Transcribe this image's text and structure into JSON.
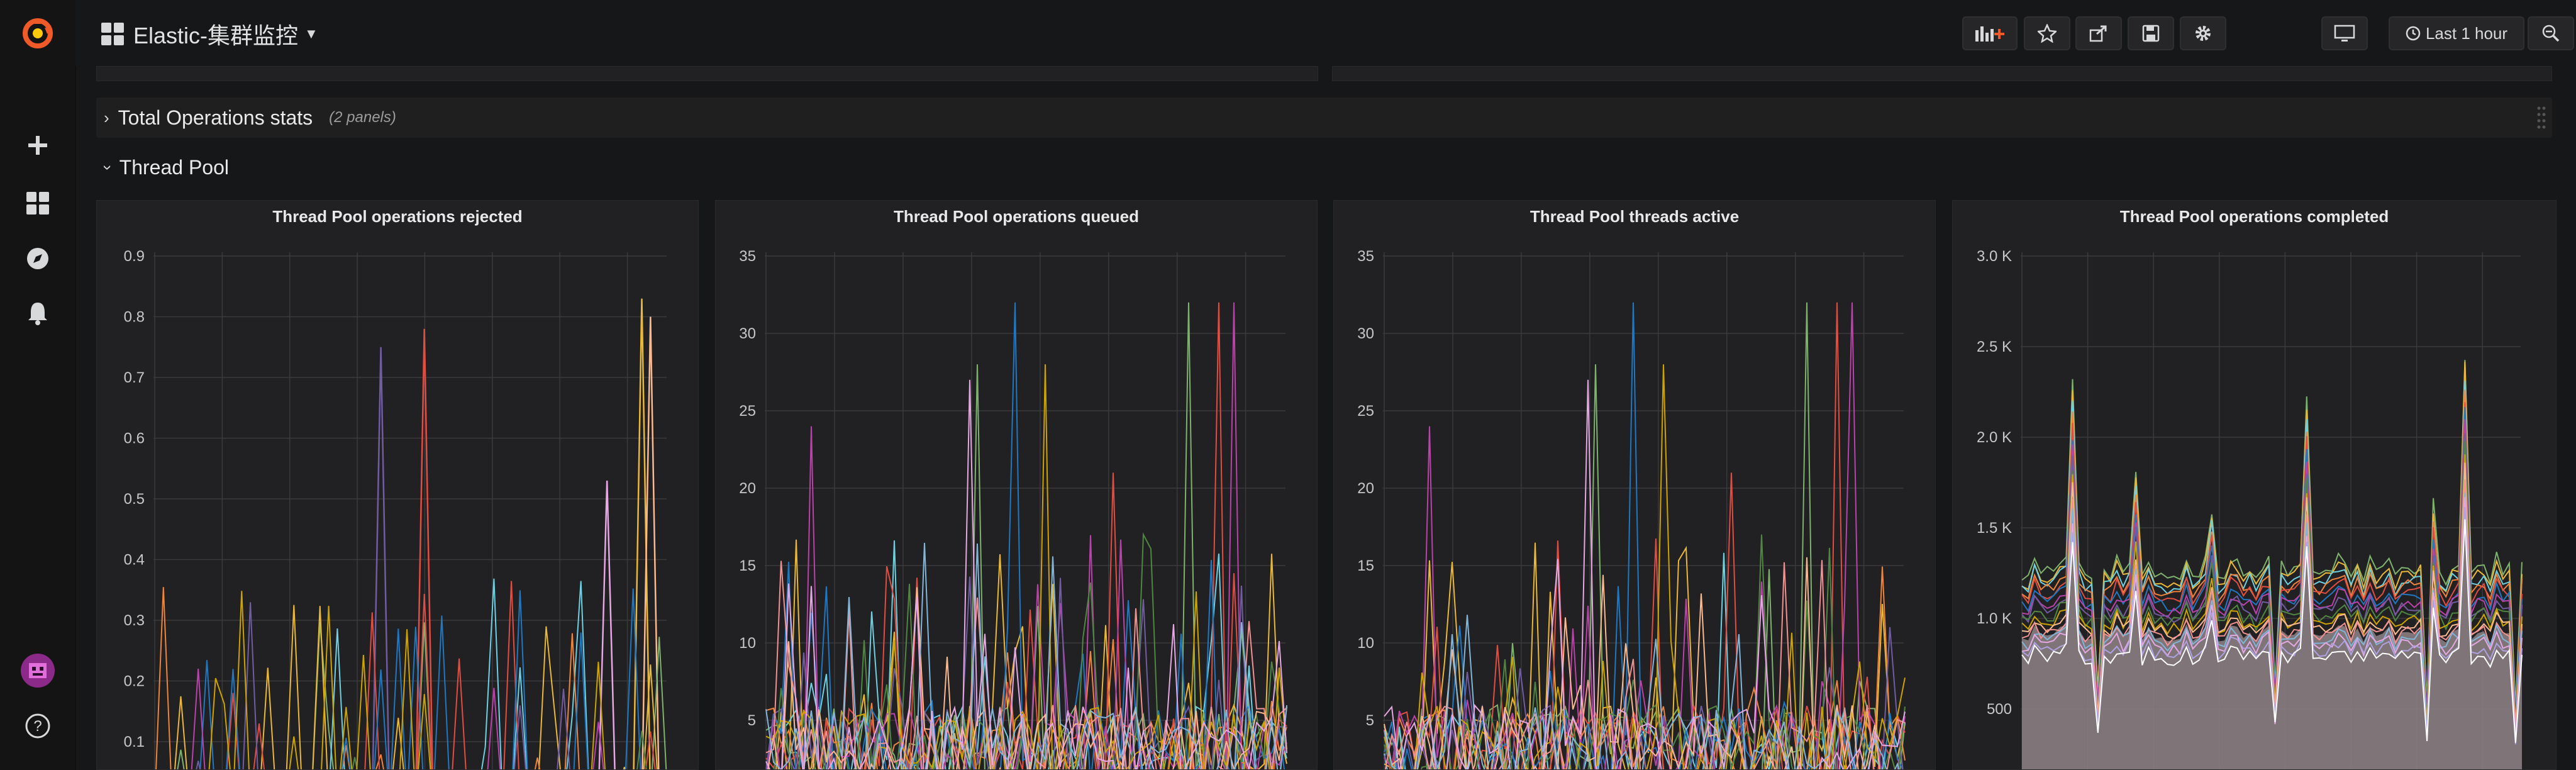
{
  "dashboard": {
    "title": "Elastic-集群监控"
  },
  "toolbar": {
    "time_range_label": "Last 1 hour"
  },
  "sidebar": {
    "items": [
      "grafana-logo",
      "create",
      "dashboards",
      "explore",
      "alerting",
      "user-avatar",
      "help"
    ]
  },
  "rows": [
    {
      "title": "Total Operations stats",
      "count_label": "(2 panels)",
      "collapsed": true
    },
    {
      "title": "Thread Pool",
      "collapsed": false
    }
  ],
  "panels": [
    {
      "title": "Thread Pool operations rejected",
      "yticks": [
        "0.9",
        "0.8",
        "0.7",
        "0.6",
        "0.5",
        "0.4",
        "0.3",
        "0.2",
        "0.1"
      ]
    },
    {
      "title": "Thread Pool operations queued",
      "yticks": [
        "35",
        "30",
        "25",
        "20",
        "15",
        "10",
        "5"
      ]
    },
    {
      "title": "Thread Pool threads active",
      "yticks": [
        "35",
        "30",
        "25",
        "20",
        "15",
        "10",
        "5"
      ]
    },
    {
      "title": "Thread Pool operations completed",
      "yticks": [
        "3.0 K",
        "2.5 K",
        "2.0 K",
        "1.5 K",
        "1.0 K",
        "500"
      ]
    }
  ],
  "colors": {
    "background": "#161719",
    "panel": "#212124",
    "accent": "#f05a28",
    "series": [
      "#7eb26d",
      "#eab839",
      "#6ed0e0",
      "#ef843c",
      "#e24d42",
      "#1f78c1",
      "#ba43a9",
      "#705da0",
      "#508642",
      "#cca300",
      "#f9ba8f",
      "#f29191",
      "#82b5d8",
      "#e5a8e2",
      "#aea2e0",
      "#ffffff"
    ]
  },
  "chart_data": [
    {
      "type": "line",
      "title": "Thread Pool operations rejected",
      "ylim": [
        0,
        0.9
      ],
      "x": [
        0,
        1,
        2,
        3,
        4,
        5,
        6,
        7,
        8,
        9,
        10,
        11,
        12,
        13,
        14,
        15,
        16,
        17,
        18,
        19,
        20,
        21,
        22,
        23,
        24,
        25,
        26,
        27,
        28,
        29,
        30,
        31,
        32,
        33,
        34,
        35,
        36,
        37,
        38,
        39,
        40,
        41,
        42,
        43,
        44,
        45,
        46,
        47,
        48,
        49,
        50,
        51,
        52,
        53,
        54,
        55,
        56,
        57,
        58,
        59
      ],
      "series": [
        {
          "values": [
            0,
            0,
            0,
            0,
            0,
            0,
            0,
            0,
            0,
            0,
            0,
            0,
            0,
            0,
            0,
            0,
            0,
            0,
            0,
            0,
            0,
            0,
            0,
            0,
            0,
            0,
            0,
            0,
            0,
            0,
            0,
            0,
            0,
            0,
            0,
            0,
            0,
            0,
            0,
            0,
            0,
            0,
            0,
            0,
            0,
            0,
            0,
            0,
            0,
            0,
            0,
            0,
            0,
            0,
            0,
            0,
            0.83,
            0,
            0,
            0
          ]
        },
        {
          "values": [
            0,
            0,
            0,
            0,
            0,
            0,
            0,
            0,
            0,
            0,
            0,
            0,
            0,
            0,
            0,
            0,
            0,
            0,
            0,
            0,
            0,
            0,
            0,
            0,
            0,
            0,
            0,
            0,
            0,
            0,
            0,
            0.78,
            0,
            0,
            0,
            0,
            0,
            0,
            0,
            0,
            0,
            0,
            0,
            0,
            0,
            0,
            0,
            0,
            0,
            0,
            0,
            0,
            0,
            0,
            0,
            0,
            0,
            0,
            0,
            0
          ]
        },
        {
          "values": [
            0,
            0,
            0,
            0,
            0,
            0,
            0,
            0,
            0,
            0,
            0,
            0,
            0,
            0,
            0,
            0,
            0,
            0,
            0,
            0,
            0,
            0,
            0,
            0,
            0,
            0,
            0.75,
            0,
            0,
            0,
            0,
            0,
            0,
            0,
            0,
            0,
            0,
            0,
            0,
            0,
            0,
            0,
            0,
            0,
            0,
            0,
            0,
            0,
            0,
            0,
            0,
            0,
            0,
            0,
            0,
            0,
            0,
            0,
            0,
            0
          ]
        },
        {
          "values": [
            0,
            0,
            0,
            0,
            0,
            0,
            0,
            0,
            0,
            0,
            0,
            0,
            0,
            0,
            0,
            0,
            0,
            0,
            0,
            0,
            0,
            0,
            0,
            0,
            0,
            0,
            0,
            0,
            0,
            0,
            0,
            0,
            0,
            0,
            0,
            0,
            0,
            0,
            0,
            0,
            0,
            0,
            0,
            0,
            0,
            0,
            0,
            0,
            0,
            0,
            0,
            0,
            0,
            0,
            0,
            0,
            0,
            0.8,
            0,
            0
          ]
        },
        {
          "values": [
            0,
            0,
            0,
            0,
            0,
            0,
            0,
            0,
            0,
            0,
            0,
            0,
            0,
            0,
            0,
            0,
            0,
            0,
            0,
            0,
            0,
            0,
            0,
            0,
            0,
            0,
            0,
            0,
            0,
            0,
            0,
            0,
            0,
            0,
            0,
            0,
            0,
            0,
            0,
            0,
            0,
            0,
            0,
            0,
            0,
            0,
            0,
            0,
            0,
            0,
            0,
            0,
            0.53,
            0,
            0,
            0,
            0,
            0,
            0,
            0
          ]
        }
      ]
    },
    {
      "type": "line",
      "title": "Thread Pool operations queued",
      "ylim": [
        0,
        35
      ]
    },
    {
      "type": "line",
      "title": "Thread Pool threads active",
      "ylim": [
        0,
        35
      ]
    },
    {
      "type": "area",
      "title": "Thread Pool operations completed",
      "ylim": [
        0,
        3000
      ]
    }
  ]
}
